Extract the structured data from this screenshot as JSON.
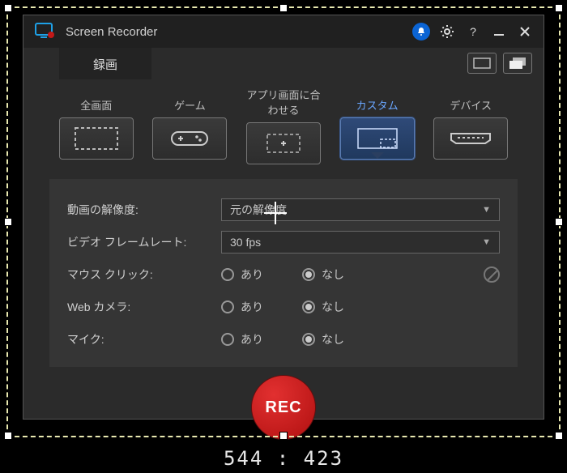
{
  "app_title": "Screen Recorder",
  "tab_record": "録画",
  "capture_tabs": [
    {
      "label": "全画面",
      "icon": "fullscreen"
    },
    {
      "label": "ゲーム",
      "icon": "gamepad"
    },
    {
      "label": "アプリ画面に合わせる",
      "icon": "fit-app"
    },
    {
      "label": "カスタム",
      "icon": "custom",
      "active": true
    },
    {
      "label": "デバイス",
      "icon": "device"
    }
  ],
  "settings": {
    "resolution_label": "動画の解像度:",
    "resolution_value": "元の解像度",
    "framerate_label": "ビデオ フレームレート:",
    "framerate_value": "30 fps",
    "mouse_click_label": "マウス クリック:",
    "webcam_label": "Web カメラ:",
    "mic_label": "マイク:",
    "opt_yes": "あり",
    "opt_no": "なし",
    "mouse_click": "no",
    "webcam": "no",
    "mic": "no"
  },
  "rec_label": "REC",
  "selection_size": "544  :  423"
}
